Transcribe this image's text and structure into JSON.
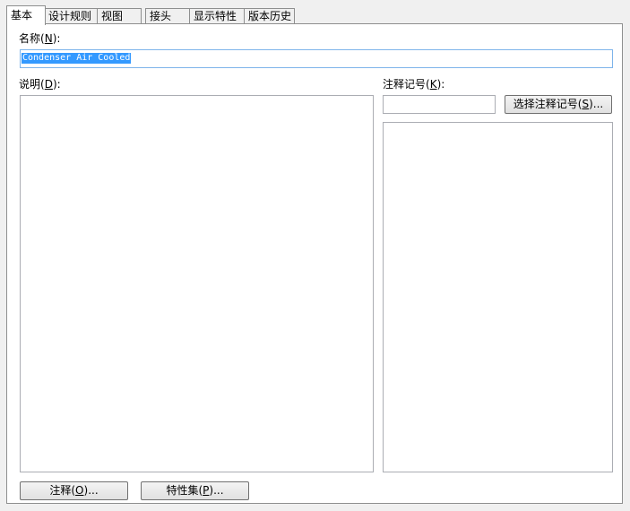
{
  "tabs": [
    {
      "label": "基本",
      "active": true
    },
    {
      "label": "设计规则",
      "active": false
    },
    {
      "label": "视图",
      "active": false
    },
    {
      "label": "接头",
      "active": false
    },
    {
      "label": "显示特性",
      "active": false
    },
    {
      "label": "版本历史",
      "active": false
    }
  ],
  "name": {
    "label": "名称",
    "accel": "N",
    "value": "Condenser Air Cooled"
  },
  "description": {
    "label": "说明",
    "accel": "D",
    "value": ""
  },
  "keynote": {
    "label": "注释记号",
    "accel": "K",
    "value": "",
    "select_button": {
      "label": "选择注释记号",
      "accel": "S",
      "suffix": "..."
    }
  },
  "buttons": {
    "notes": {
      "label": "注释",
      "accel": "O",
      "suffix": "..."
    },
    "property_sets": {
      "label": "特性集",
      "accel": "P",
      "suffix": "..."
    }
  }
}
